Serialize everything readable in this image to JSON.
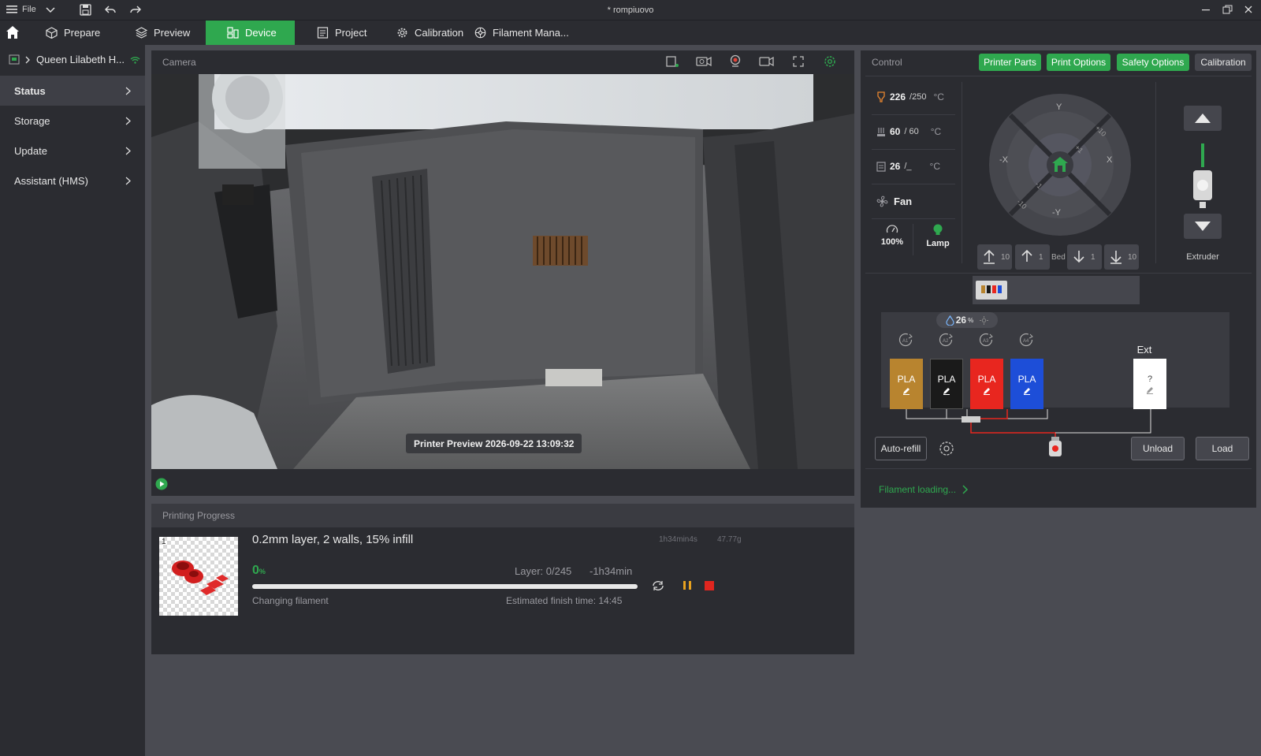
{
  "titlebar": {
    "menu_label": "File",
    "doc_title": "* rompiuovo"
  },
  "nav": {
    "tabs": [
      {
        "label": "Prepare"
      },
      {
        "label": "Preview"
      },
      {
        "label": "Device"
      },
      {
        "label": "Project"
      },
      {
        "label": "Calibration"
      },
      {
        "label": "Filament Mana..."
      }
    ]
  },
  "sidebar": {
    "printer_name": "Queen Lilabeth H...",
    "items": [
      {
        "label": "Status"
      },
      {
        "label": "Storage"
      },
      {
        "label": "Update"
      },
      {
        "label": "Assistant (HMS)"
      }
    ]
  },
  "camera": {
    "title": "Camera",
    "overlay": "Printer Preview  2026-09-22 13:09:32"
  },
  "progress": {
    "title": "Printing Progress",
    "plate_number": "1",
    "job_name": "0.2mm layer, 2 walls, 15% infill",
    "est_time": "1h34min4s",
    "weight": "47.77g",
    "percent": "0",
    "percent_unit": "%",
    "percent_value": 0,
    "layer": "Layer: 0/245",
    "remaining": "-1h34min",
    "stage": "Changing filament",
    "finish": "Estimated finish time: 14:45"
  },
  "control": {
    "title": "Control",
    "tabs": [
      "Printer Parts",
      "Print Options",
      "Safety Options",
      "Calibration"
    ],
    "nozzle": {
      "current": "226",
      "target": "/250",
      "unit": "°C"
    },
    "bed": {
      "current": "60",
      "target": "/ 60",
      "unit": "°C"
    },
    "chamber": {
      "current": "26",
      "target": "/_",
      "unit": "°C"
    },
    "fan_label": "Fan",
    "speed": "100%",
    "lamp_label": "Lamp",
    "jog": {
      "y": "Y",
      "neg_y": "-Y",
      "x": "X",
      "neg_x": "-X",
      "p10": "+10",
      "p1": "+1",
      "m1": "-1",
      "m10": "-10"
    },
    "bed_buttons": {
      "up10": "10",
      "up1": "1",
      "bed": "Bed",
      "down1": "1",
      "down10": "10"
    },
    "extruder_label": "Extruder"
  },
  "ams": {
    "humidity": "26",
    "humidity_unit": "%",
    "slots": [
      {
        "id": "A1",
        "type": "PLA",
        "color": "#b8842f"
      },
      {
        "id": "A2",
        "type": "PLA",
        "color": "#1a1a1a"
      },
      {
        "id": "A3",
        "type": "PLA",
        "color": "#e8261f"
      },
      {
        "id": "A4",
        "type": "PLA",
        "color": "#1d4ed8"
      }
    ],
    "ext": {
      "label": "Ext",
      "type": "?"
    },
    "auto_refill": "Auto-refill",
    "unload": "Unload",
    "load": "Load",
    "status": "Filament loading..."
  },
  "colors": {
    "accent": "#2fa84f",
    "panel": "#2b2c31",
    "background": "#4a4b52"
  }
}
